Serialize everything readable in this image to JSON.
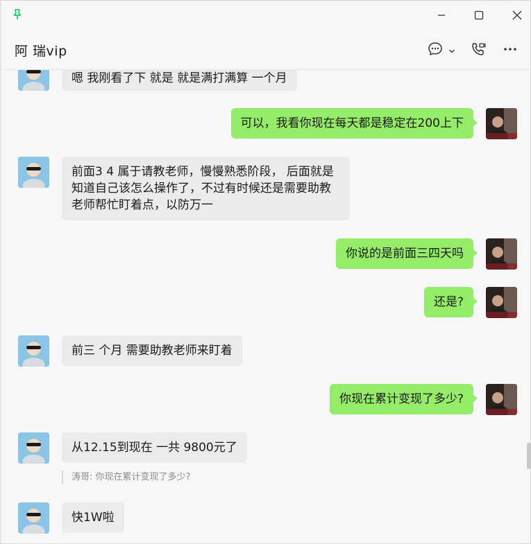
{
  "window": {
    "pin_icon": "pin-icon",
    "minimize_icon": "minimize-icon",
    "maximize_icon": "maximize-icon",
    "close_icon": "close-icon"
  },
  "header": {
    "title": "阿 瑞vip",
    "icons": [
      "chat-bubble-icon",
      "chevron-down-icon",
      "video-call-icon",
      "more-icon"
    ]
  },
  "colors": {
    "accent_green": "#95ec69",
    "pin_green": "#07c160",
    "bubble_gray": "#ebebeb",
    "background": "#f7f7f7"
  },
  "messages": [
    {
      "side": "left",
      "text": "嗯   我刚看了下  就是 就是满打满算 一个月"
    },
    {
      "side": "right",
      "text": "可以，我看你现在每天都是稳定在200上下"
    },
    {
      "side": "left",
      "text": "前面3    4    属于请教老师，慢慢熟悉阶段，  后面就是知道自己该怎么操作了，不过有时候还是需要助教老师帮忙盯着点，以防万一"
    },
    {
      "side": "right",
      "text": "你说的是前面三四天吗"
    },
    {
      "side": "right",
      "text": "还是?"
    },
    {
      "side": "left",
      "text": "前三 个月   需要助教老师来盯着"
    },
    {
      "side": "right",
      "text": "你现在累计变现了多少?"
    },
    {
      "side": "left",
      "text": "从12.15到现在  一共 9800元了"
    },
    {
      "side": "left",
      "text": "快1W啦"
    }
  ],
  "quote": {
    "text": "涛哥: 你现在累计变现了多少?"
  }
}
